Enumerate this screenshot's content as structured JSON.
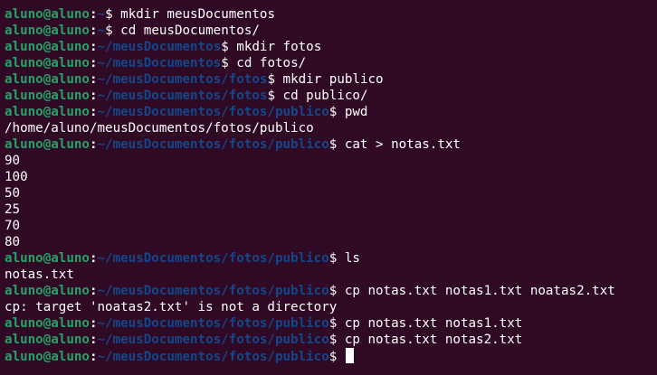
{
  "terminal": {
    "prompt_user": "aluno@aluno",
    "colors": {
      "background": "#300a24",
      "user": "#26a269",
      "path": "#12488b",
      "text": "#ffffff"
    },
    "lines": [
      {
        "type": "prompt",
        "path": "~",
        "cmd": " mkdir meusDocumentos"
      },
      {
        "type": "prompt",
        "path": "~",
        "cmd": " cd meusDocumentos/"
      },
      {
        "type": "prompt",
        "path": "~/meusDocumentos",
        "cmd": " mkdir fotos"
      },
      {
        "type": "prompt",
        "path": "~/meusDocumentos",
        "cmd": " cd fotos/"
      },
      {
        "type": "prompt",
        "path": "~/meusDocumentos/fotos",
        "cmd": " mkdir publico"
      },
      {
        "type": "prompt",
        "path": "~/meusDocumentos/fotos",
        "cmd": " cd publico/"
      },
      {
        "type": "prompt",
        "path": "~/meusDocumentos/fotos/publico",
        "cmd": " pwd"
      },
      {
        "type": "output",
        "text": "/home/aluno/meusDocumentos/fotos/publico"
      },
      {
        "type": "prompt",
        "path": "~/meusDocumentos/fotos/publico",
        "cmd": " cat > notas.txt"
      },
      {
        "type": "output",
        "text": "90"
      },
      {
        "type": "output",
        "text": "100"
      },
      {
        "type": "output",
        "text": "50"
      },
      {
        "type": "output",
        "text": "25"
      },
      {
        "type": "output",
        "text": "70"
      },
      {
        "type": "output",
        "text": "80"
      },
      {
        "type": "prompt",
        "path": "~/meusDocumentos/fotos/publico",
        "cmd": " ls"
      },
      {
        "type": "output",
        "text": "notas.txt"
      },
      {
        "type": "prompt",
        "path": "~/meusDocumentos/fotos/publico",
        "cmd": " cp notas.txt notas1.txt noatas2.txt"
      },
      {
        "type": "output",
        "text": "cp: target 'noatas2.txt' is not a directory"
      },
      {
        "type": "prompt",
        "path": "~/meusDocumentos/fotos/publico",
        "cmd": " cp notas.txt notas1.txt"
      },
      {
        "type": "prompt",
        "path": "~/meusDocumentos/fotos/publico",
        "cmd": " cp notas.txt notas2.txt"
      },
      {
        "type": "prompt",
        "path": "~/meusDocumentos/fotos/publico",
        "cmd": " ",
        "cursor": true
      }
    ]
  }
}
